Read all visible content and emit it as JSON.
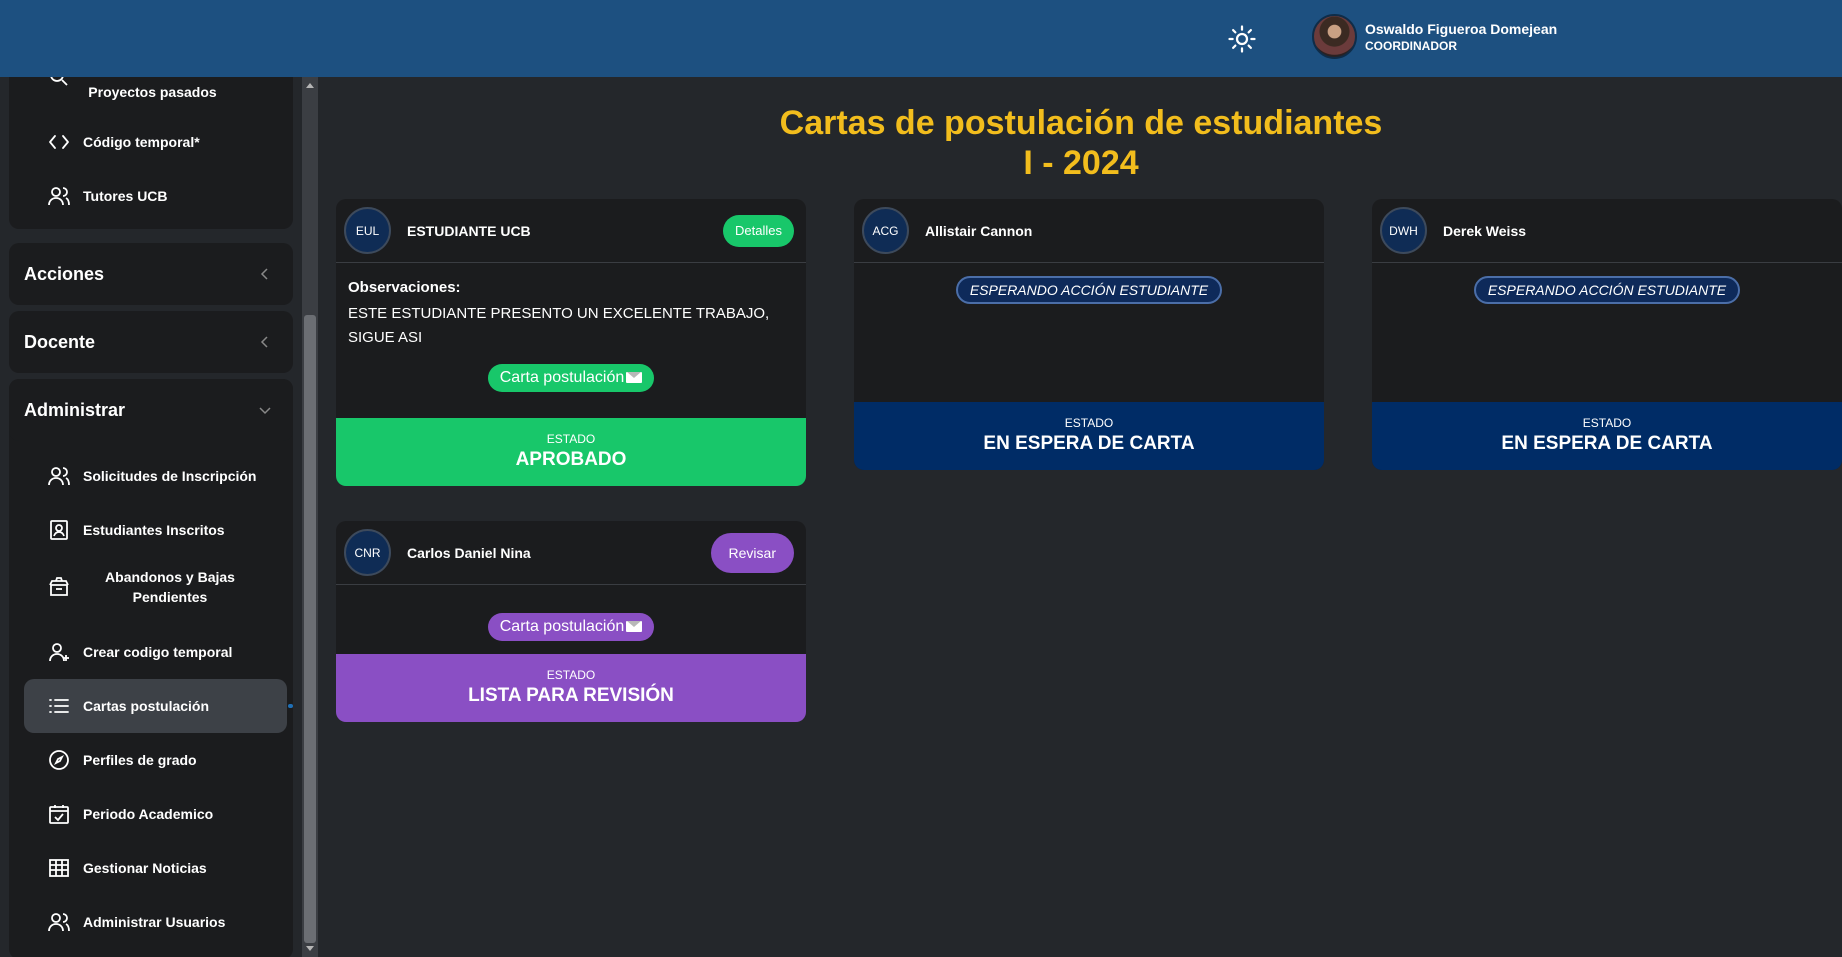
{
  "topbar": {
    "theme_icon": "sun-icon",
    "user_name": "Oswaldo Figueroa Domejean",
    "user_role": "COORDINADOR"
  },
  "sidebar": {
    "top_items": [
      {
        "label": "Proyectos pasados",
        "icon": "search-icon"
      },
      {
        "label": "Código temporal*",
        "icon": "code-icon"
      },
      {
        "label": "Tutores UCB",
        "icon": "users-icon"
      }
    ],
    "groups": {
      "acciones": "Acciones",
      "docente": "Docente",
      "administrar": "Administrar"
    },
    "admin_items": [
      {
        "label": "Solicitudes de Inscripción",
        "icon": "users-icon"
      },
      {
        "label": "Estudiantes Inscritos",
        "icon": "id-badge-icon"
      },
      {
        "label": "Abandonos y Bajas Pendientes",
        "icon": "trash-icon"
      },
      {
        "label": "Crear codigo temporal",
        "icon": "user-plus-icon"
      },
      {
        "label": "Cartas postulación",
        "icon": "list-icon"
      },
      {
        "label": "Perfiles de grado",
        "icon": "compass-icon"
      },
      {
        "label": "Periodo Academico",
        "icon": "calendar-check-icon"
      },
      {
        "label": "Gestionar Noticias",
        "icon": "table-icon"
      },
      {
        "label": "Administrar Usuarios",
        "icon": "users-icon"
      }
    ]
  },
  "main": {
    "title_line1": "Cartas de postulación de estudiantes",
    "title_line2": "I - 2024",
    "cards": [
      {
        "initials": "EUL",
        "name": "ESTUDIANTE UCB",
        "head_button": "Detalles",
        "obs_title": "Observaciones:",
        "obs_text": "ESTE ESTUDIANTE PRESENTO UN EXCELENTE TRABAJO, SIGUE ASI",
        "letter_button": "Carta postulación",
        "status_label": "ESTADO",
        "status_value": "APROBADO"
      },
      {
        "initials": "ACG",
        "name": "Allistair Cannon",
        "badge": "ESPERANDO ACCIÓN ESTUDIANTE",
        "status_label": "ESTADO",
        "status_value": "EN ESPERA DE CARTA"
      },
      {
        "initials": "DWH",
        "name": "Derek Weiss",
        "badge": "ESPERANDO ACCIÓN ESTUDIANTE",
        "status_label": "ESTADO",
        "status_value": "EN ESPERA DE CARTA"
      },
      {
        "initials": "CNR",
        "name": "Carlos Daniel Nina",
        "head_button": "Revisar",
        "letter_button": "Carta postulación",
        "status_label": "ESTADO",
        "status_value": "LISTA PARA REVISIÓN"
      }
    ]
  },
  "colors": {
    "topbar": "#1d5080",
    "title": "#f2bd1d",
    "approved": "#18c76a",
    "waiting": "#002c66",
    "review": "#8a4fc4"
  }
}
